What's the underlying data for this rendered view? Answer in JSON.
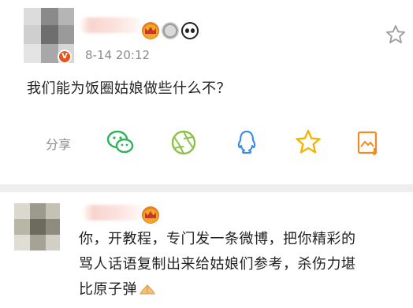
{
  "post": {
    "time": "8-14 20:12",
    "vip_badge": "V",
    "text": "我们能为饭圈姑娘做些什么不？",
    "badges": [
      "crown-icon",
      "medal-icon",
      "panda-icon"
    ],
    "share_label": "分享",
    "share_targets": [
      "wechat-icon",
      "moments-icon",
      "qq-icon",
      "qzone-icon",
      "save-image-icon"
    ]
  },
  "comment": {
    "line1": "你，开教程，专门发一条微博，把你精彩的",
    "line2": "骂人话语复制出来给姑娘们参考，杀伤力堪",
    "line3": "比原子弹"
  },
  "colors": {
    "accent_green": "#2fb35a",
    "accent_blue": "#3a8ee6",
    "accent_yellow": "#f4b400",
    "icon_orange": "#f08a24",
    "muted_text": "#8a8a8a"
  }
}
